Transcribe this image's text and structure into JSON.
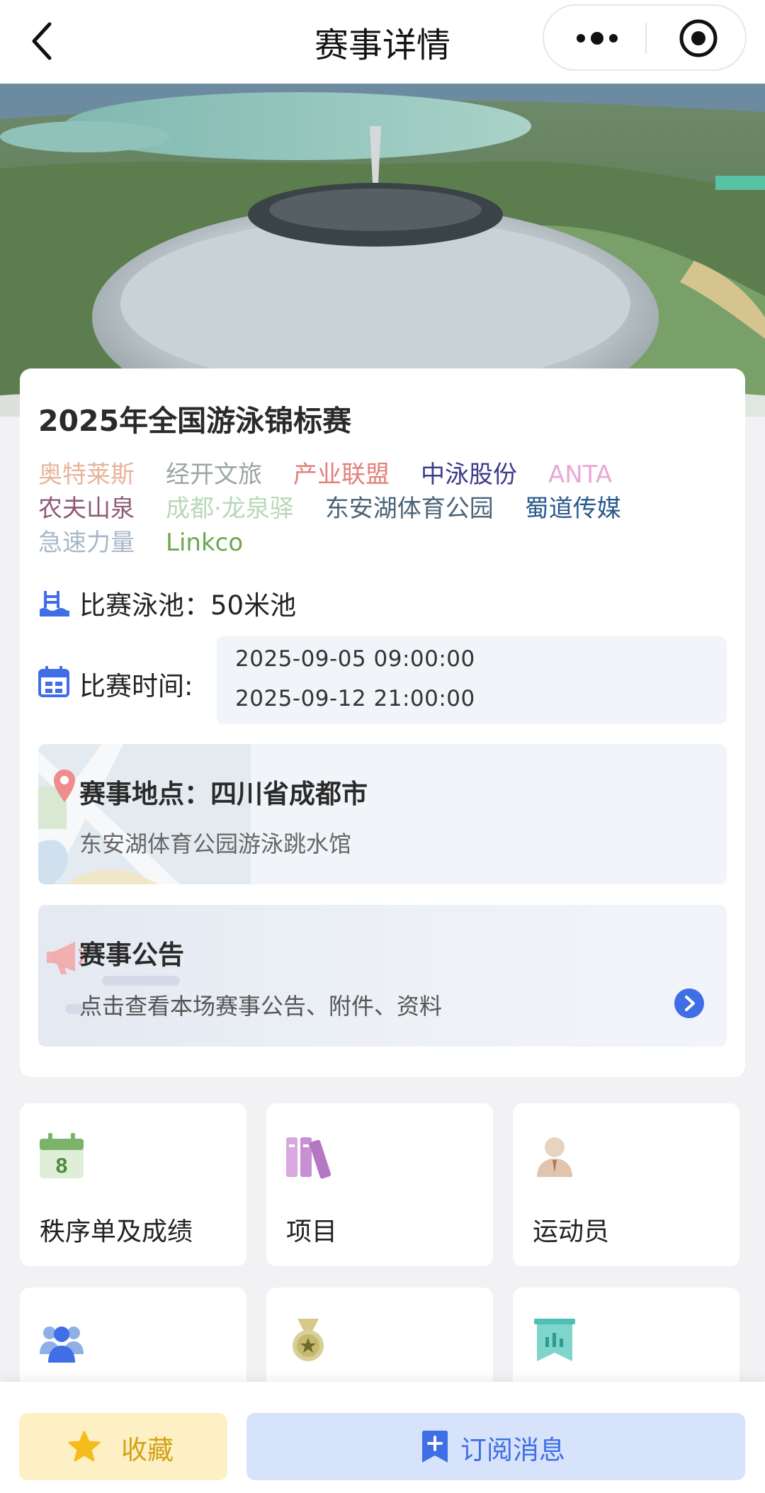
{
  "nav": {
    "title": "赛事详情"
  },
  "event": {
    "title": "2025年全国游泳锦标赛",
    "sponsors": [
      {
        "name": "奥特莱斯",
        "color": "#e8b49a"
      },
      {
        "name": "经开文旅",
        "color": "#9aa7a0"
      },
      {
        "name": "产业联盟",
        "color": "#e2807a"
      },
      {
        "name": "中泳股份",
        "color": "#3c3a8c"
      },
      {
        "name": "ANTA",
        "color": "#e8a8d8"
      },
      {
        "name": "农夫山泉",
        "color": "#8e5a78"
      },
      {
        "name": "成都·龙泉驿",
        "color": "#b8d8b8"
      },
      {
        "name": "东安湖体育公园",
        "color": "#4a6478"
      },
      {
        "name": "蜀道传媒",
        "color": "#2a5a8c"
      },
      {
        "name": "急速力量",
        "color": "#a8b8c8"
      },
      {
        "name": "Linkco",
        "color": "#6aa84f"
      }
    ],
    "pool_label": "比赛泳池：",
    "pool_value": "50米池",
    "time_label": "比赛时间:",
    "time_start": "2025-09-05 09:00:00",
    "time_end": "2025-09-12 21:00:00",
    "location_label": "赛事地点：",
    "location_city": "四川省成都市",
    "location_venue": "东安湖体育公园游泳跳水馆",
    "notice_title": "赛事公告",
    "notice_sub": "点击查看本场赛事公告、附件、资料"
  },
  "tiles": [
    {
      "label": "秩序单及成绩",
      "icon": "calendar-8-icon"
    },
    {
      "label": "项目",
      "icon": "books-icon"
    },
    {
      "label": "运动员",
      "icon": "athlete-icon"
    },
    {
      "label": "",
      "icon": "team-icon"
    },
    {
      "label": "",
      "icon": "medal-icon"
    },
    {
      "label": "",
      "icon": "stats-banner-icon"
    }
  ],
  "bottom": {
    "favorite_label": "收藏",
    "subscribe_label": "订阅消息"
  },
  "colors": {
    "accent": "#3f6ee6",
    "favorite": "#d4a21a"
  }
}
